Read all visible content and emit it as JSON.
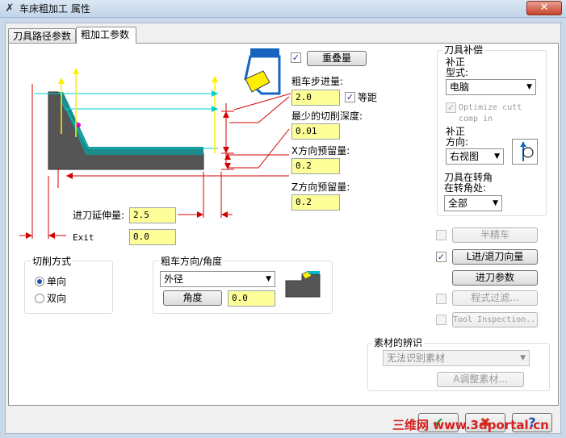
{
  "window": {
    "title": "车床粗加工 属性",
    "close_label": "✕"
  },
  "tabs": [
    {
      "label": "刀具路径参数",
      "active": false
    },
    {
      "label": "粗加工参数",
      "active": true
    }
  ],
  "overlap": {
    "checked": true,
    "button_label": "重叠量"
  },
  "stepover": {
    "label": "粗车步进量:",
    "value": "2.0",
    "equal_dist_checked": true,
    "equal_dist_label": "等距"
  },
  "min_depth": {
    "label": "最少的切削深度:",
    "value": "0.01"
  },
  "x_stock": {
    "label": "X方向预留量:",
    "value": "0.2"
  },
  "z_stock": {
    "label": "Z方向预留量:",
    "value": "0.2"
  },
  "entry_ext": {
    "label": "进刀延伸量:",
    "value": "2.5"
  },
  "exit": {
    "label": "Exit",
    "value": "0.0"
  },
  "cut_method": {
    "title": "切削方式",
    "options": [
      "单向",
      "双向"
    ],
    "selected": 0
  },
  "rough_direction": {
    "title": "粗车方向/角度",
    "selected": "外径",
    "angle_button": "角度",
    "angle_value": "0.0"
  },
  "tool_comp": {
    "title": "刀具补偿",
    "comp_type_label_1": "补正",
    "comp_type_label_2": "型式:",
    "comp_type_value": "电脑",
    "optimize_checked": true,
    "optimize_label_1": "Optimize cutt",
    "optimize_label_2": "comp in",
    "comp_dir_label_1": "补正",
    "comp_dir_label_2": "方向:",
    "comp_dir_value": "右视图",
    "corner_label_1": "刀具在转角",
    "corner_label_2": "在转角处:",
    "corner_value": "全部"
  },
  "right_buttons": [
    {
      "label": "半精车",
      "checked": false,
      "enabled": false
    },
    {
      "label": "L进/退刀向量",
      "checked": true,
      "enabled": true
    },
    {
      "label": "进刀参数",
      "checked": null,
      "enabled": true
    },
    {
      "label": "程式过滤...",
      "checked": false,
      "enabled": false
    },
    {
      "label": "Tool Inspection...",
      "checked": false,
      "enabled": false
    }
  ],
  "stock_recognition": {
    "title": "素材的辨识",
    "selected": "无法识别素材",
    "adjust_button": "A调整素材..."
  },
  "footer": {
    "ok": "✔",
    "cancel": "✖",
    "help": "?"
  },
  "watermark": "三维网 www.3dportal.cn",
  "colors": {
    "input_bg": "#ffff99",
    "part_fill": "#555555",
    "part_edge": "#1f8c8c",
    "dim_red": "#d40000",
    "dim_yellow": "#ffee00",
    "dim_cyan": "#00d0d0"
  }
}
